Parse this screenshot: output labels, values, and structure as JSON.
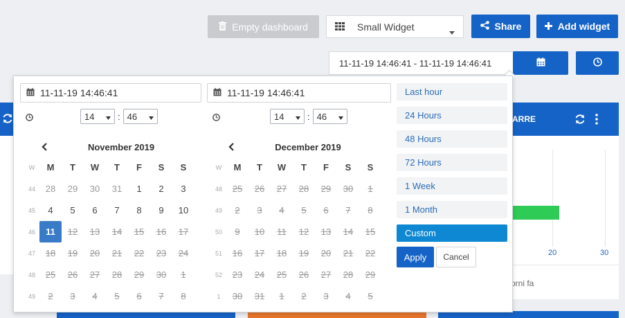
{
  "toolbar": {
    "empty_dashboard": "Empty dashboard",
    "widget_size": "Small Widget",
    "share": "Share",
    "add_widget": "Add widget"
  },
  "range": {
    "value": "11-11-19 14:46:41 - 11-11-19 14:46:41"
  },
  "background": {
    "widget_title_fragment": "ARRE",
    "axis_tick_1": "20",
    "axis_tick_2": "30",
    "footer_text": "orni fa"
  },
  "picker": {
    "start": {
      "date": "11-11-19 14:46:41",
      "hour": "14",
      "minute": "46"
    },
    "end": {
      "date": "11-11-19 14:46:41",
      "hour": "14",
      "minute": "46"
    },
    "time_sep": ":",
    "dow": [
      "W",
      "M",
      "T",
      "W",
      "T",
      "F",
      "S",
      "S"
    ],
    "left_cal": {
      "title": "November 2019",
      "weeks": [
        {
          "wk": "44",
          "days": [
            "28",
            "29",
            "30",
            "31",
            "1",
            "2",
            "3"
          ],
          "cls": [
            "other",
            "other",
            "other",
            "other",
            "",
            "",
            ""
          ]
        },
        {
          "wk": "45",
          "days": [
            "4",
            "5",
            "6",
            "7",
            "8",
            "9",
            "10"
          ],
          "cls": [
            "",
            "",
            "",
            "",
            "",
            "",
            ""
          ]
        },
        {
          "wk": "46",
          "days": [
            "11",
            "12",
            "13",
            "14",
            "15",
            "16",
            "17"
          ],
          "cls": [
            "sel",
            "disabled",
            "disabled",
            "disabled",
            "disabled",
            "disabled",
            "disabled"
          ]
        },
        {
          "wk": "47",
          "days": [
            "18",
            "19",
            "20",
            "21",
            "22",
            "23",
            "24"
          ],
          "cls": [
            "disabled",
            "disabled",
            "disabled",
            "disabled",
            "disabled",
            "disabled",
            "disabled"
          ]
        },
        {
          "wk": "48",
          "days": [
            "25",
            "26",
            "27",
            "28",
            "29",
            "30",
            "1"
          ],
          "cls": [
            "disabled",
            "disabled",
            "disabled",
            "disabled",
            "disabled",
            "disabled",
            "disabled"
          ]
        },
        {
          "wk": "49",
          "days": [
            "2",
            "3",
            "4",
            "5",
            "6",
            "7",
            "8"
          ],
          "cls": [
            "disabled",
            "disabled",
            "disabled",
            "disabled",
            "disabled",
            "disabled",
            "disabled"
          ]
        }
      ]
    },
    "right_cal": {
      "title": "December 2019",
      "weeks": [
        {
          "wk": "48",
          "days": [
            "25",
            "26",
            "27",
            "28",
            "29",
            "30",
            "1"
          ],
          "cls": [
            "disabled",
            "disabled",
            "disabled",
            "disabled",
            "disabled",
            "disabled",
            "disabled"
          ]
        },
        {
          "wk": "49",
          "days": [
            "2",
            "3",
            "4",
            "5",
            "6",
            "7",
            "8"
          ],
          "cls": [
            "disabled",
            "disabled",
            "disabled",
            "disabled",
            "disabled",
            "disabled",
            "disabled"
          ]
        },
        {
          "wk": "50",
          "days": [
            "9",
            "10",
            "11",
            "12",
            "13",
            "14",
            "15"
          ],
          "cls": [
            "disabled",
            "disabled",
            "disabled",
            "disabled",
            "disabled",
            "disabled",
            "disabled"
          ]
        },
        {
          "wk": "51",
          "days": [
            "16",
            "17",
            "18",
            "19",
            "20",
            "21",
            "22"
          ],
          "cls": [
            "disabled",
            "disabled",
            "disabled",
            "disabled",
            "disabled",
            "disabled",
            "disabled"
          ]
        },
        {
          "wk": "52",
          "days": [
            "23",
            "24",
            "25",
            "26",
            "27",
            "28",
            "29"
          ],
          "cls": [
            "disabled",
            "disabled",
            "disabled",
            "disabled",
            "disabled",
            "disabled",
            "disabled"
          ]
        },
        {
          "wk": "1",
          "days": [
            "30",
            "31",
            "1",
            "2",
            "3",
            "4",
            "5"
          ],
          "cls": [
            "disabled",
            "disabled",
            "disabled",
            "disabled",
            "disabled",
            "disabled",
            "disabled"
          ]
        }
      ]
    },
    "ranges": [
      "Last hour",
      "24 Hours",
      "48 Hours",
      "72 Hours",
      "1 Week",
      "1 Month",
      "Custom"
    ],
    "active_range": "Custom",
    "apply": "Apply",
    "cancel": "Cancel"
  },
  "colors": {
    "primary": "#1663c7",
    "active_range": "#0e88d3",
    "selected_day": "#3a7bc8",
    "bar_green": "#2ecc57",
    "orange": "#e8762d"
  }
}
